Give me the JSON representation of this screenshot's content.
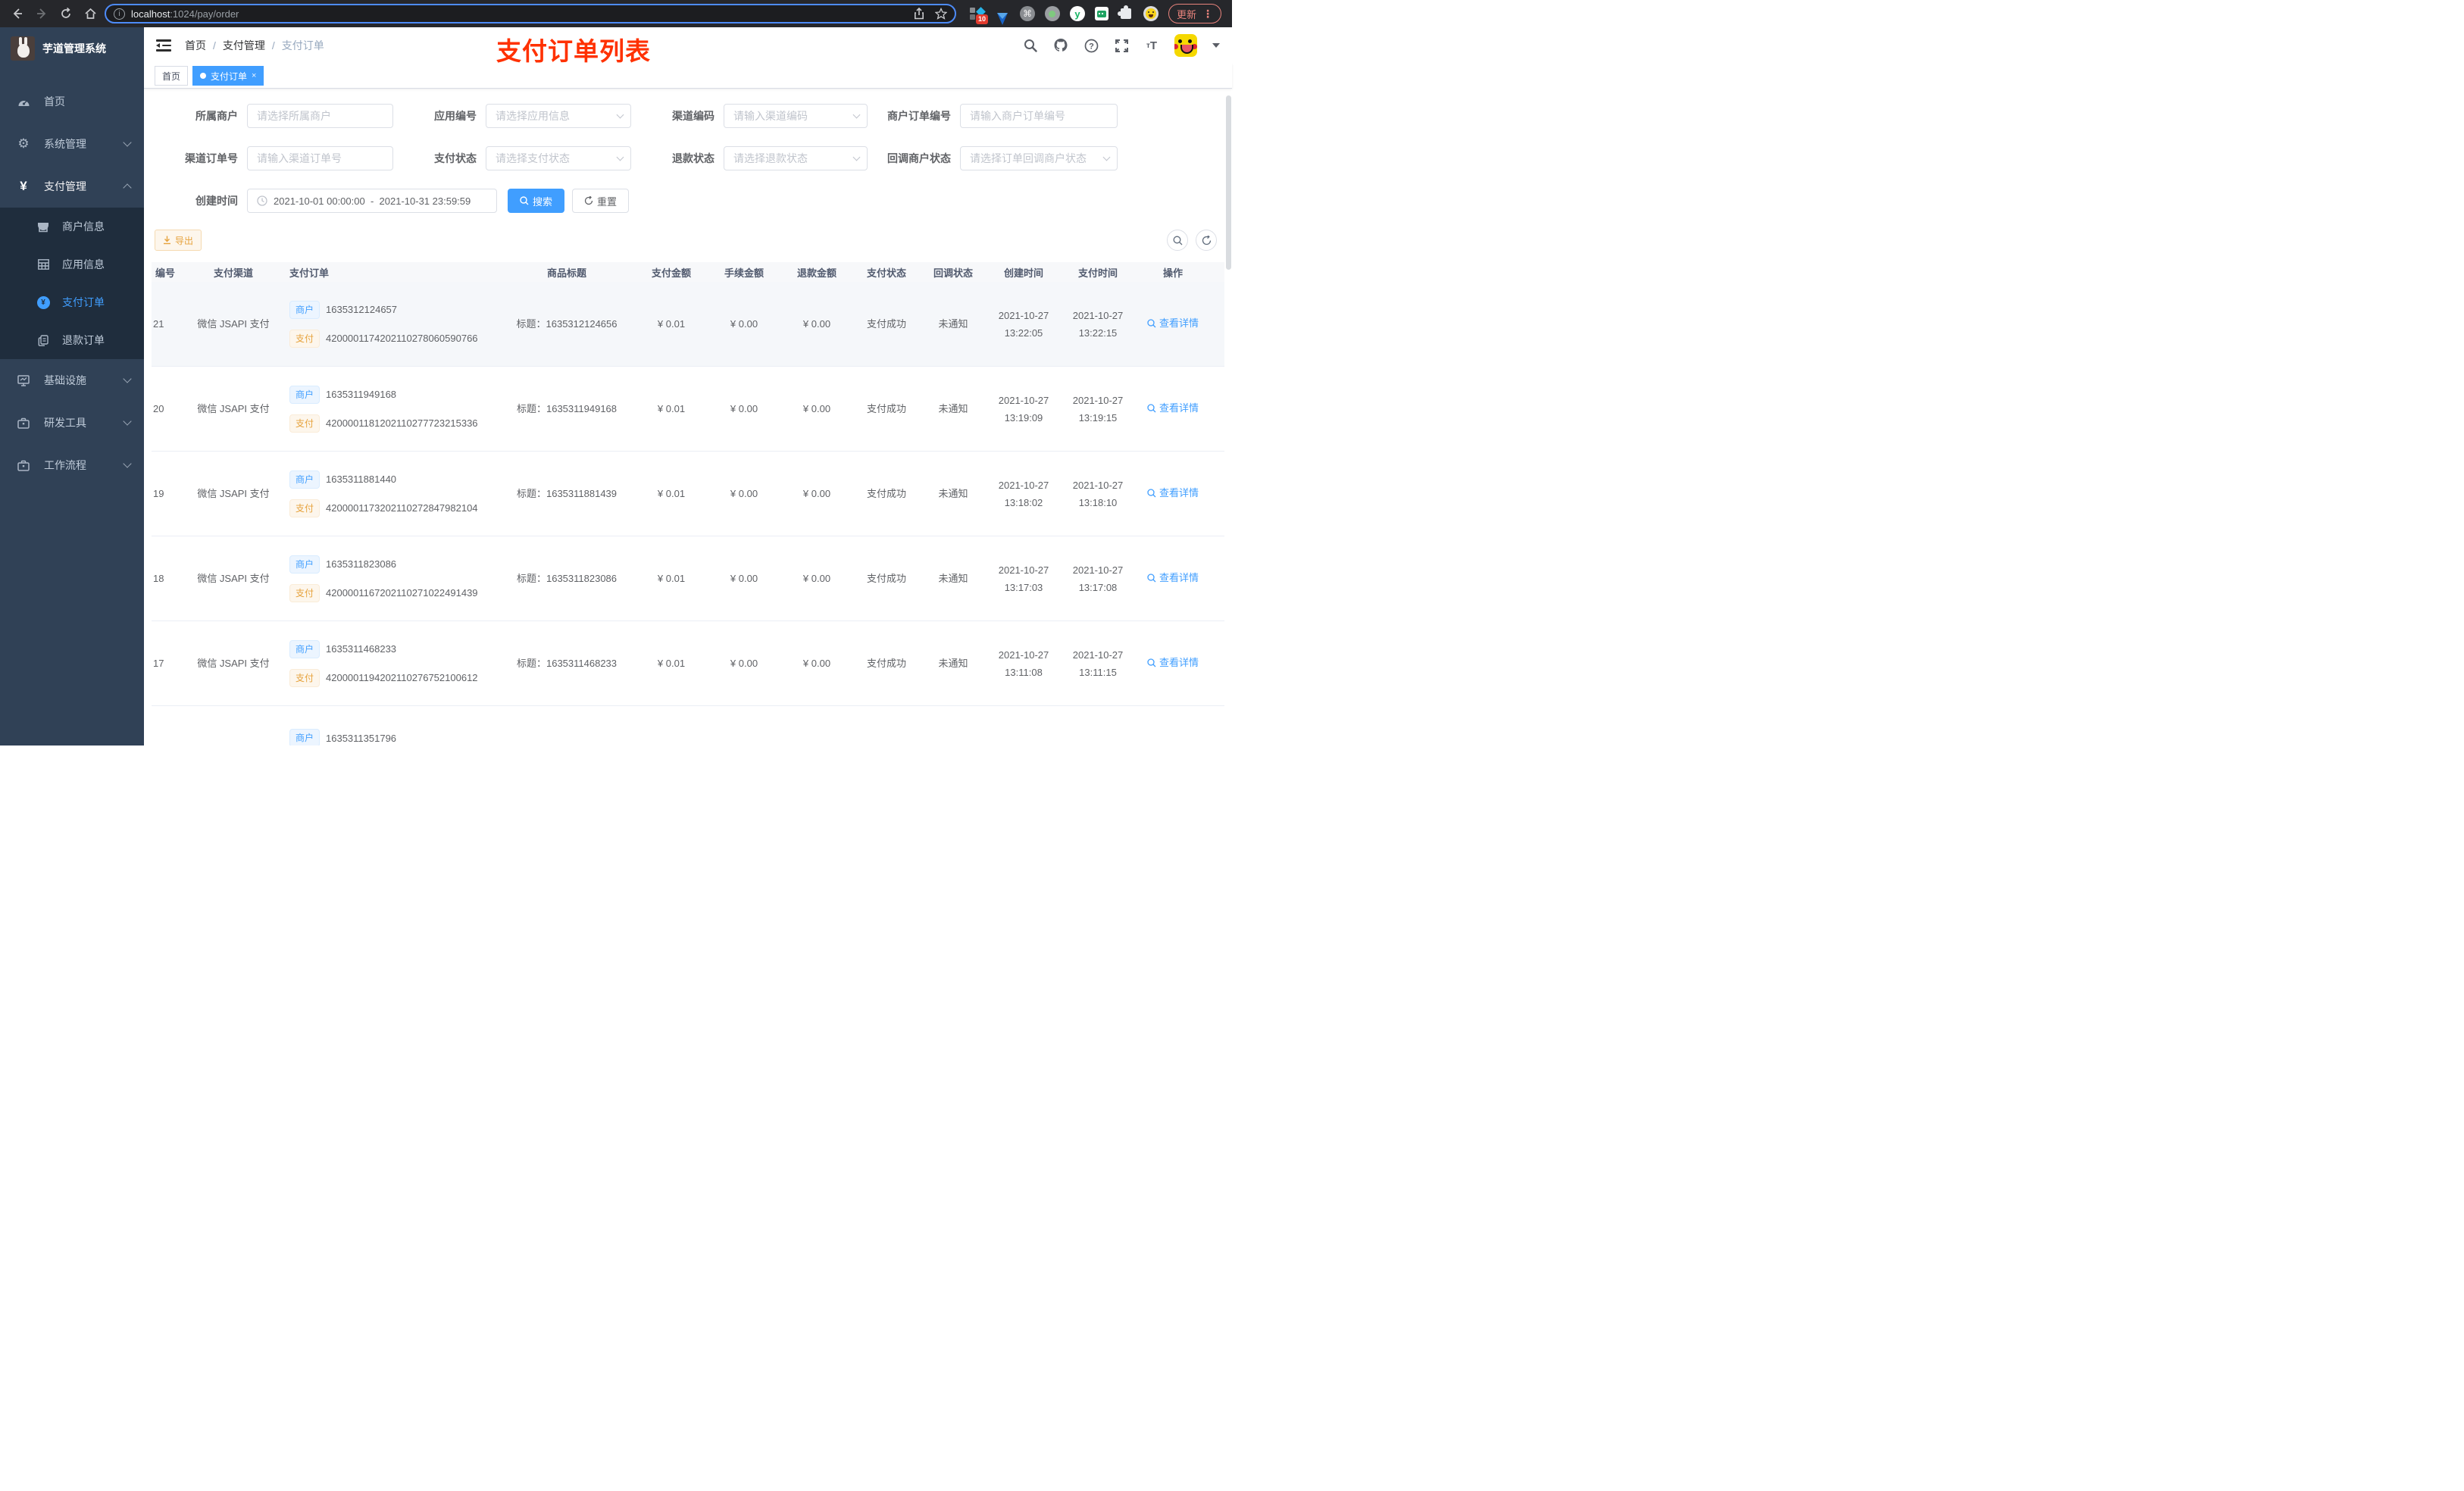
{
  "colors": {
    "accent": "#409eff",
    "annotation_red": "#ff3100",
    "sidebar_bg": "#304156",
    "submenu_bg": "#1f2d3d",
    "chrome_bg": "#26272b",
    "tag_blue_text": "#409eff",
    "tag_yellow_text": "#e6a23c",
    "active_tab_bg": "#409eff",
    "update_button_color": "#e8837c"
  },
  "browser": {
    "url_host": "localhost",
    "url_rest": ":1024/pay/order",
    "extension_badge": "10",
    "update_label": "更新",
    "menu_dots": "⋮"
  },
  "sidebar": {
    "app_title": "芋道管理系统",
    "items": [
      {
        "label": "首页"
      },
      {
        "label": "系统管理"
      },
      {
        "label": "支付管理"
      },
      {
        "label": "商户信息"
      },
      {
        "label": "应用信息"
      },
      {
        "label": "支付订单"
      },
      {
        "label": "退款订单"
      },
      {
        "label": "基础设施"
      },
      {
        "label": "研发工具"
      },
      {
        "label": "工作流程"
      }
    ]
  },
  "header": {
    "breadcrumb": {
      "home": "首页",
      "section": "支付管理",
      "current": "支付订单"
    },
    "separator": "/",
    "annotation": "支付订单列表",
    "fontsize_small": "т",
    "fontsize_big": "T"
  },
  "tags": {
    "home": "首页",
    "current": "支付订单",
    "close": "×"
  },
  "filters": {
    "fields": [
      {
        "label": "所属商户",
        "placeholder": "请选择所属商户"
      },
      {
        "label": "应用编号",
        "placeholder": "请选择应用信息"
      },
      {
        "label": "渠道编码",
        "placeholder": "请输入渠道编码"
      },
      {
        "label": "商户订单编号",
        "placeholder": "请输入商户订单编号"
      },
      {
        "label": "渠道订单号",
        "placeholder": "请输入渠道订单号"
      },
      {
        "label": "支付状态",
        "placeholder": "请选择支付状态"
      },
      {
        "label": "退款状态",
        "placeholder": "请选择退款状态"
      },
      {
        "label": "回调商户状态",
        "placeholder": "请选择订单回调商户状态"
      }
    ],
    "date_label": "创建时间",
    "date_start": "2021-10-01 00:00:00",
    "date_sep": "-",
    "date_end": "2021-10-31 23:59:59",
    "search_label": "搜索",
    "reset_label": "重置",
    "export_label": "导出"
  },
  "table": {
    "headers": [
      "编号",
      "支付渠道",
      "支付订单",
      "商品标题",
      "支付金额",
      "手续金额",
      "退款金额",
      "支付状态",
      "回调状态",
      "创建时间",
      "支付时间",
      "操作"
    ],
    "tag_merchant": "商户",
    "tag_pay": "支付",
    "rows": [
      {
        "no": "21",
        "channel": "微信 JSAPI 支付",
        "merchant_no": "1635312124657",
        "pay_no": "4200001174202110278060590766",
        "title": "标题：1635312124656",
        "amount": "¥ 0.01",
        "fee": "¥ 0.00",
        "refund": "¥ 0.00",
        "status": "支付成功",
        "notify": "未通知",
        "create_date": "2021-10-27",
        "create_time": "13:22:05",
        "pay_date": "2021-10-27",
        "pay_time": "13:22:15",
        "action": "查看详情"
      },
      {
        "no": "20",
        "channel": "微信 JSAPI 支付",
        "merchant_no": "1635311949168",
        "pay_no": "4200001181202110277723215336",
        "title": "标题：1635311949168",
        "amount": "¥ 0.01",
        "fee": "¥ 0.00",
        "refund": "¥ 0.00",
        "status": "支付成功",
        "notify": "未通知",
        "create_date": "2021-10-27",
        "create_time": "13:19:09",
        "pay_date": "2021-10-27",
        "pay_time": "13:19:15",
        "action": "查看详情"
      },
      {
        "no": "19",
        "channel": "微信 JSAPI 支付",
        "merchant_no": "1635311881440",
        "pay_no": "4200001173202110272847982104",
        "title": "标题：1635311881439",
        "amount": "¥ 0.01",
        "fee": "¥ 0.00",
        "refund": "¥ 0.00",
        "status": "支付成功",
        "notify": "未通知",
        "create_date": "2021-10-27",
        "create_time": "13:18:02",
        "pay_date": "2021-10-27",
        "pay_time": "13:18:10",
        "action": "查看详情"
      },
      {
        "no": "18",
        "channel": "微信 JSAPI 支付",
        "merchant_no": "1635311823086",
        "pay_no": "4200001167202110271022491439",
        "title": "标题：1635311823086",
        "amount": "¥ 0.01",
        "fee": "¥ 0.00",
        "refund": "¥ 0.00",
        "status": "支付成功",
        "notify": "未通知",
        "create_date": "2021-10-27",
        "create_time": "13:17:03",
        "pay_date": "2021-10-27",
        "pay_time": "13:17:08",
        "action": "查看详情"
      },
      {
        "no": "17",
        "channel": "微信 JSAPI 支付",
        "merchant_no": "1635311468233",
        "pay_no": "4200001194202110276752100612",
        "title": "标题：1635311468233",
        "amount": "¥ 0.01",
        "fee": "¥ 0.00",
        "refund": "¥ 0.00",
        "status": "支付成功",
        "notify": "未通知",
        "create_date": "2021-10-27",
        "create_time": "13:11:08",
        "pay_date": "2021-10-27",
        "pay_time": "13:11:15",
        "action": "查看详情"
      }
    ],
    "partial_row": {
      "merchant_no": "1635311351796"
    }
  }
}
